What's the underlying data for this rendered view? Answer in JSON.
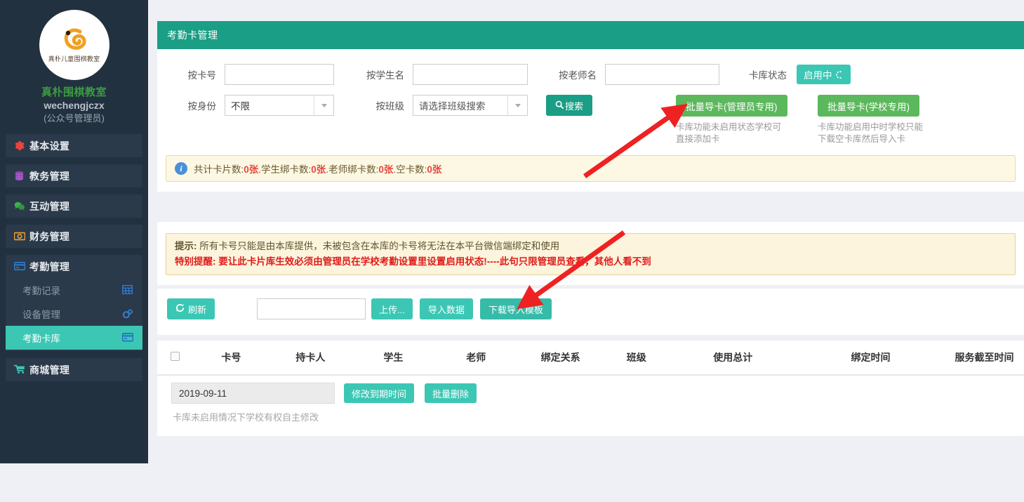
{
  "sidebar": {
    "logo": {
      "badge_text": "真朴儿童围棋教室"
    },
    "brand_cn": "真朴围棋教室",
    "brand_en": "wechengjczx",
    "brand_role": "(公众号管理员)",
    "menu": [
      {
        "label": "基本设置",
        "icon": "gear-icon",
        "icon_color": "#e8453c"
      },
      {
        "label": "教务管理",
        "icon": "database-icon",
        "icon_color": "#8e44ad"
      },
      {
        "label": "互动管理",
        "icon": "wechat-icon",
        "icon_color": "#3eae4a"
      },
      {
        "label": "财务管理",
        "icon": "money-icon",
        "icon_color": "#f0a030"
      },
      {
        "label": "考勤管理",
        "icon": "card-icon",
        "icon_color": "#2f7fd0"
      },
      {
        "label": "商城管理",
        "icon": "cart-icon",
        "icon_color": "#3bc7b4"
      }
    ],
    "submenu": [
      {
        "label": "考勤记录",
        "icon": "table-icon",
        "active": false
      },
      {
        "label": "设备管理",
        "icon": "cogs-icon",
        "active": false
      },
      {
        "label": "考勤卡库",
        "icon": "card-icon",
        "active": true
      }
    ]
  },
  "panel": {
    "title": "考勤卡管理",
    "fields": {
      "card_no": {
        "label": "按卡号",
        "value": "",
        "placeholder": ""
      },
      "student": {
        "label": "按学生名",
        "value": "",
        "placeholder": ""
      },
      "teacher": {
        "label": "按老师名",
        "value": "",
        "placeholder": ""
      },
      "identity": {
        "label": "按身份",
        "value": "不限"
      },
      "class": {
        "label": "按班级",
        "value": "请选择班级搜索"
      }
    },
    "card_status": {
      "label": "卡库状态",
      "badge": "启用中"
    },
    "search_button": "搜索",
    "batch_admin": {
      "label": "批量导卡(管理员专用)",
      "help": "卡库功能未启用状态学校可直接添加卡"
    },
    "batch_school": {
      "label": "批量导卡(学校专用)",
      "help": "卡库功能启用中时学校只能下载空卡库然后导入卡"
    },
    "summary": {
      "seg1": "共计卡片数:",
      "v1": "0张",
      "seg2": ".学生绑卡数:",
      "v2": "0张",
      "seg3": ".老师绑卡数:",
      "v3": "0张",
      "seg4": ".空卡数:",
      "v4": "0张"
    }
  },
  "tips": {
    "line1_label": "提示:",
    "line1_text": "所有卡号只能是由本库提供，未被包含在本库的卡号将无法在本平台微信端绑定和使用",
    "line2_strong": "特别提醒: 要让此卡片库生效必须由管理员在学校考勤设置里设置启用状态!----此句只限管理员查看，其他人看不到"
  },
  "toolbar": {
    "refresh": "刷新",
    "file_value": "",
    "upload": "上传...",
    "import": "导入数据",
    "download_template": "下载导入模板"
  },
  "table": {
    "columns": [
      "卡号",
      "持卡人",
      "学生",
      "老师",
      "绑定关系",
      "班级",
      "使用总计",
      "绑定时间",
      "服务截至时间"
    ]
  },
  "footer": {
    "date_value": "2019-09-11",
    "edit_expiry": "修改到期时间",
    "batch_delete": "批量删除",
    "note": "卡库未启用情况下学校有权自主修改"
  },
  "colors": {
    "sidebar_bg": "#22313f",
    "panel_header": "#1a9e85",
    "accent_mint": "#3bc7b4",
    "accent_green": "#5cb85c",
    "arrow_red": "#ee2222",
    "alert_yellow": "#fcf8e3"
  }
}
